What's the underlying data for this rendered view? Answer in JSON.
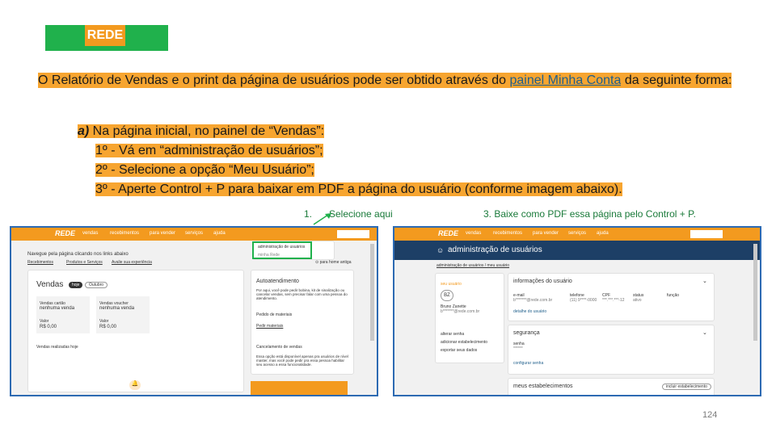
{
  "brand": {
    "logo_text": "REDE",
    "bar_color": "#20b14c",
    "tag_color": "#f39a1f"
  },
  "intro": {
    "part1": "O Relatório de Vendas e o print da página de usuários pode ser obtido através do ",
    "link": "painel Minha Conta",
    "part2": " da seguinte forma:"
  },
  "steps": {
    "letter": "a)",
    "heading": " Na página inicial, no painel de “Vendas”:",
    "items": [
      "1º - Vá em “administração de usuários”;",
      "2º - Selecione a opção “Meu Usuário”;",
      "3º - Aperte Control + P para baixar em PDF a página do usuário (conforme imagem abaixo)."
    ]
  },
  "callouts": {
    "one_number": "1.",
    "one_text": "Selecione aqui",
    "three": "3. Baixe como PDF essa página pelo Control  + P."
  },
  "left_shot": {
    "nav": [
      "vendas",
      "recebimentos",
      "para vender",
      "serviços",
      "ajuda"
    ],
    "menu_item_1": "administração de usuários",
    "menu_item_2": "minha Rede",
    "navigate_text": "Navegue pela página clicando nos links abaixo",
    "tabs": [
      "Recebimentos",
      "Produtos e Serviços",
      "Avalie sua experiência"
    ],
    "home_link": "⊙ para home antiga",
    "vendas_title": "Vendas",
    "chip_hoje": "hoje",
    "chip_outubro": "Outubro",
    "card1_label": "Vendas cartão",
    "card1_value": "nenhuma venda",
    "card2_label": "Vendas voucher",
    "card2_value": "nenhuma venda",
    "valor_label": "Valor",
    "valor_amount": "R$ 0,00",
    "vendas_hoje": "Vendas realizadas hoje",
    "auto_title": "Autoatendimento",
    "auto_desc": "Por aqui, você pode pedir bobina, kit de sinalização ou cancelar vendas, sem precisar falar com uma pessoa do atendimento.",
    "pedido": "Pedido de materiais",
    "pedir": "Pedir materiais",
    "cancel_title": "Cancelamento de vendas",
    "cancel_desc": "Essa opção está disponível apenas pra usuários de nível master, mas você pode pedir pra essa pessoa habilitar seu acesso a essa funcionalidade."
  },
  "right_shot": {
    "nav": [
      "vendas",
      "recebimentos",
      "para vender",
      "serviços",
      "ajuda"
    ],
    "band_title": "administração de usuários",
    "breadcrumb": "administração de usuários / meu usuário",
    "meu_usuario": "seu usuário",
    "initials": "BZ",
    "name": "Bruno Zanette",
    "email_mask": "b*******@rede.com.br",
    "actions": [
      "alterar senha",
      "adicionar estabelecimento",
      "exportar seus dados"
    ],
    "info_title": "informações do usuário",
    "fields": [
      "e-mail",
      "telefone",
      "CPF",
      "status",
      "função"
    ],
    "field_values": [
      "b*******@rede.com.br",
      "(11) 9****-0000",
      "***.***.***-12",
      "ativo",
      ""
    ],
    "detalhe": "detalhe do usuário",
    "seguranca": "segurança",
    "senha_label": "senha",
    "senha_value": "******",
    "configurar": "configurar senha",
    "estab_title": "meus estabelecimentos",
    "estab_btn": "incluir estabelecimento"
  },
  "page_number": "124"
}
